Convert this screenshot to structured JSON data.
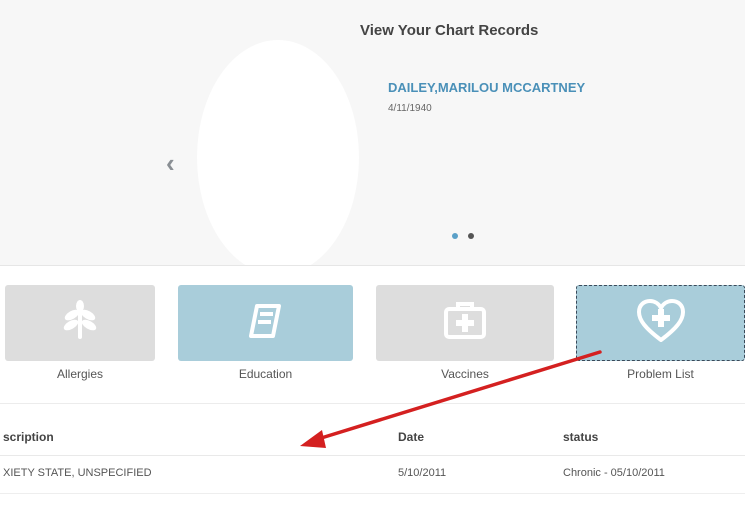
{
  "page": {
    "title": "View Your Chart Records"
  },
  "patient": {
    "name": "DAILEY,MARILOU MCCARTNEY",
    "dob": "4/11/1940"
  },
  "carousel": {
    "prev_icon": "chevron-left-icon",
    "dots": 2,
    "active_dot": 1
  },
  "tiles": [
    {
      "label": "Allergies",
      "icon": "leaf-icon",
      "state": "inactive"
    },
    {
      "label": "Education",
      "icon": "book-icon",
      "state": "active"
    },
    {
      "label": "Vaccines",
      "icon": "medical-kit-icon",
      "state": "inactive"
    },
    {
      "label": "Problem List",
      "icon": "heart-plus-icon",
      "state": "active"
    }
  ],
  "table": {
    "headers": [
      "scription",
      "Date",
      "status"
    ],
    "rows": [
      [
        "XIETY STATE, UNSPECIFIED",
        "5/10/2011",
        "Chronic - 05/10/2011"
      ]
    ]
  },
  "colors": {
    "accent": "#4a90b8",
    "tile_active": "#a9cdda",
    "tile_inactive": "#dddddd",
    "annotation_arrow": "#d42020"
  }
}
